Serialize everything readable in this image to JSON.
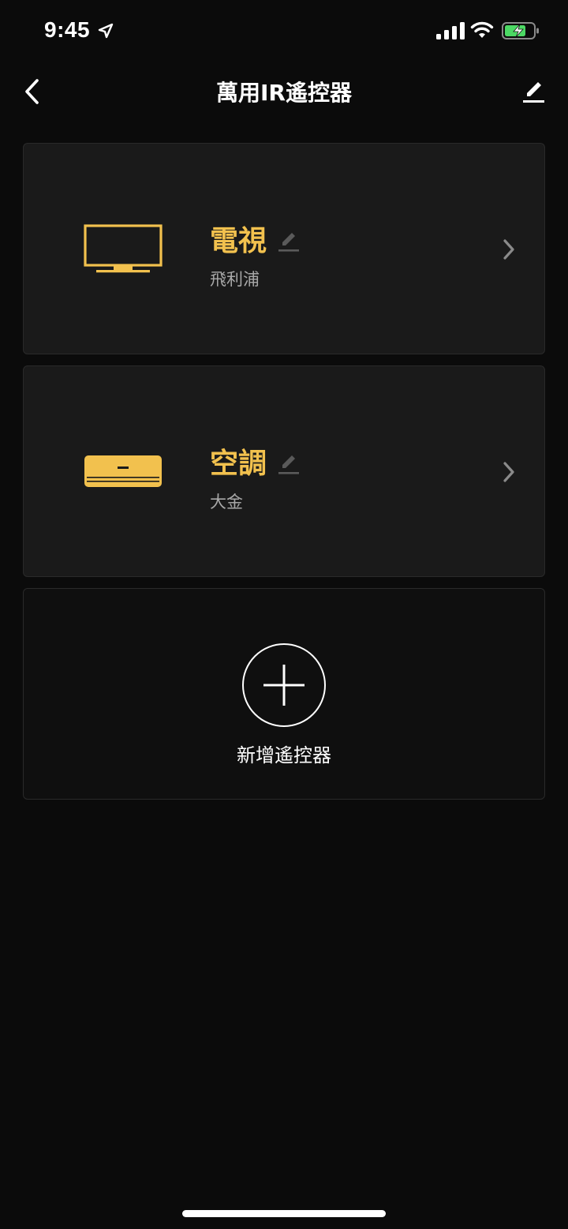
{
  "status_bar": {
    "time": "9:45",
    "icons": [
      "location-arrow-icon",
      "cellular-signal-icon",
      "wifi-icon",
      "battery-charging-icon"
    ]
  },
  "nav": {
    "title": "萬用IR遙控器",
    "back_icon": "chevron-left-icon",
    "edit_icon": "pencil-icon"
  },
  "remotes": [
    {
      "name": "電視",
      "brand": "飛利浦",
      "icon": "tv-icon"
    },
    {
      "name": "空調",
      "brand": "大金",
      "icon": "air-conditioner-icon"
    }
  ],
  "add_remote": {
    "label": "新增遙控器",
    "icon": "plus-icon"
  },
  "colors": {
    "background": "#0b0b0b",
    "card": "#1a1a1a",
    "accent": "#f2c14e",
    "secondary_text": "#a8a8a8"
  }
}
